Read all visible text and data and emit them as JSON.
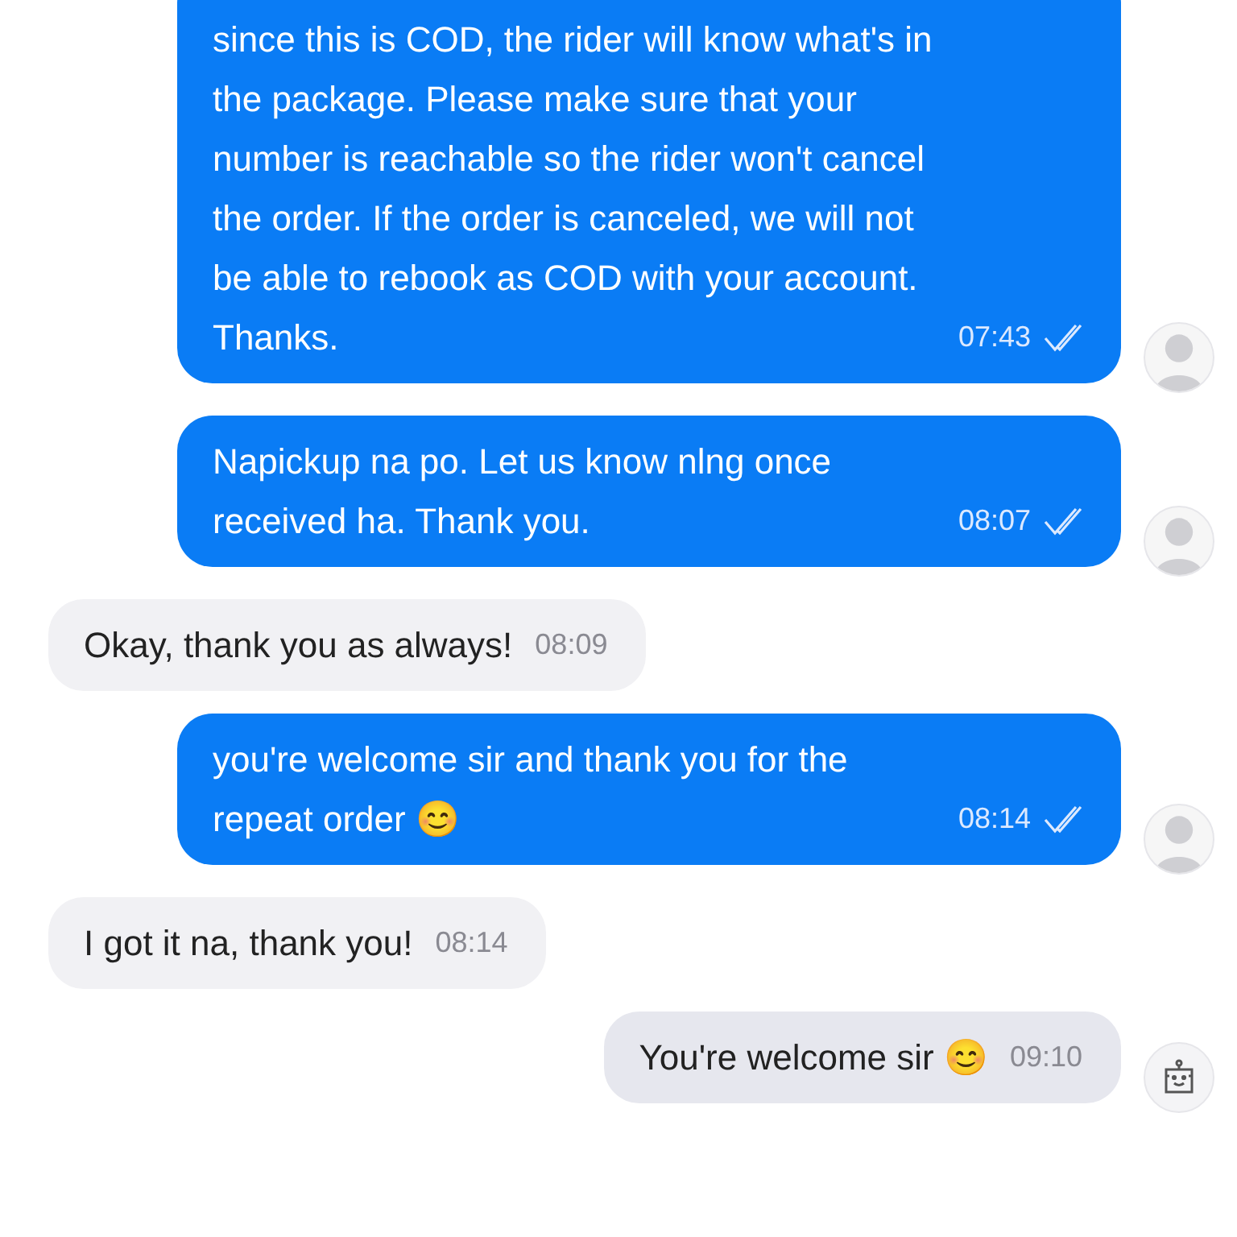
{
  "messages": [
    {
      "kind": "sent",
      "text": "since this is COD, the rider will know what's in the package. Please make sure that your number is reachable so the rider won't cancel the order. If the order is canceled, we will not be able to rebook as COD with your account. Thanks.",
      "time": "07:43",
      "read": true,
      "avatar": {
        "kind": "person"
      }
    },
    {
      "kind": "sent",
      "text": "Napickup na po. Let us know nlng once received ha. Thank you.",
      "time": "08:07",
      "read": true,
      "avatar": {
        "kind": "person"
      }
    },
    {
      "kind": "received",
      "text": "Okay, thank you as always!",
      "time": "08:09"
    },
    {
      "kind": "sent",
      "text": "you're welcome sir and thank you for the repeat order 😊",
      "time": "08:14",
      "read": true,
      "avatar": {
        "kind": "person"
      }
    },
    {
      "kind": "received",
      "text": "I got it na, thank you!",
      "time": "08:14"
    },
    {
      "kind": "auto",
      "text": "You're welcome sir 😊",
      "time": "09:10",
      "avatar": {
        "kind": "bot"
      }
    }
  ]
}
